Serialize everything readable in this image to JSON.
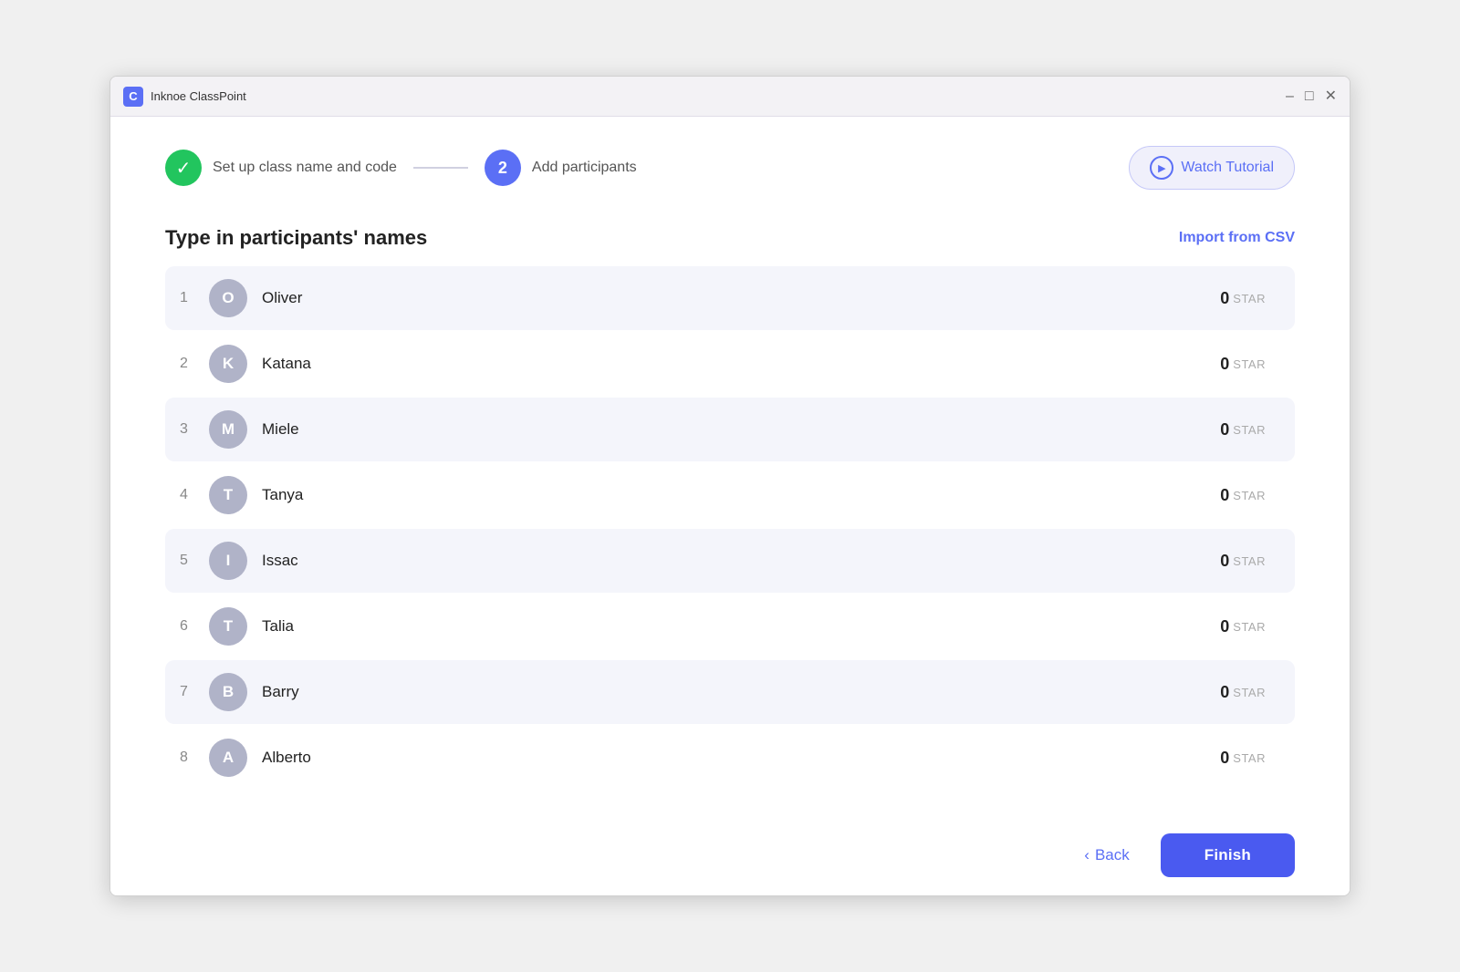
{
  "window": {
    "title": "Inknoe ClassPoint",
    "logo_letter": "C",
    "minimize_label": "–",
    "maximize_label": "□",
    "close_label": "✕"
  },
  "stepper": {
    "step1": {
      "label": "Set up class name and code",
      "done": true
    },
    "step2": {
      "number": "2",
      "label": "Add participants",
      "active": true
    }
  },
  "watch_tutorial": {
    "label": "Watch Tutorial"
  },
  "section": {
    "title": "Type in participants' names",
    "import_csv": "Import from CSV"
  },
  "participants": [
    {
      "number": "1",
      "initial": "O",
      "name": "Oliver",
      "stars": "0"
    },
    {
      "number": "2",
      "initial": "K",
      "name": "Katana",
      "stars": "0"
    },
    {
      "number": "3",
      "initial": "M",
      "name": "Miele",
      "stars": "0"
    },
    {
      "number": "4",
      "initial": "T",
      "name": "Tanya",
      "stars": "0"
    },
    {
      "number": "5",
      "initial": "I",
      "name": "Issac",
      "stars": "0"
    },
    {
      "number": "6",
      "initial": "T",
      "name": "Talia",
      "stars": "0"
    },
    {
      "number": "7",
      "initial": "B",
      "name": "Barry",
      "stars": "0"
    },
    {
      "number": "8",
      "initial": "A",
      "name": "Alberto",
      "stars": "0"
    }
  ],
  "star_label": "STAR",
  "footer": {
    "back_label": "Back",
    "finish_label": "Finish"
  }
}
